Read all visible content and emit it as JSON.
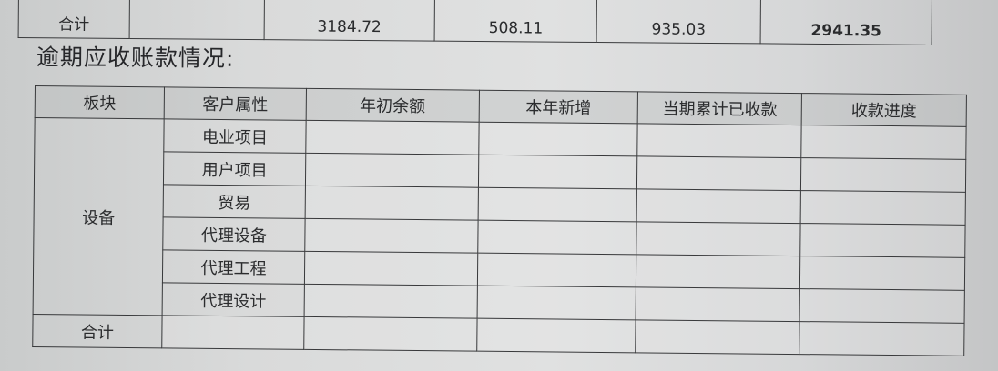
{
  "top_table": {
    "label": "合计",
    "values": [
      "3184.72",
      "508.11",
      "935.03",
      "2941.35"
    ]
  },
  "section_title": "逾期应收账款情况:",
  "table": {
    "headers": [
      "板块",
      "客户属性",
      "年初余额",
      "本年新增",
      "当期累计已收款",
      "收款进度"
    ],
    "block_label": "设备",
    "rows": [
      "电业项目",
      "用户项目",
      "贸易",
      "代理设备",
      "代理工程",
      "代理设计"
    ],
    "total_label": "合计"
  }
}
